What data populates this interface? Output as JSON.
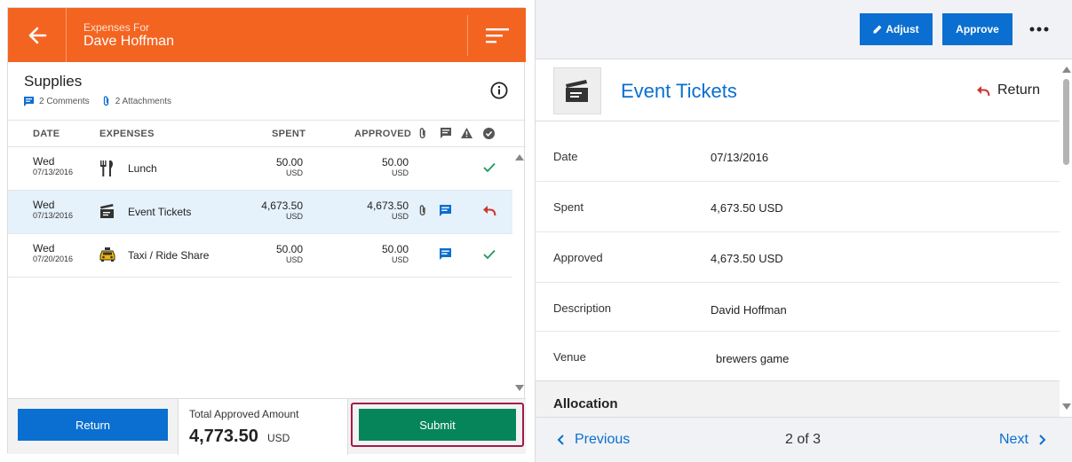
{
  "header": {
    "subtitle": "Expenses For",
    "name": "Dave Hoffman",
    "back_icon": "back-arrow-icon",
    "sort_icon": "sort-icon"
  },
  "report": {
    "title": "Supplies",
    "comments": "2 Comments",
    "attachments": "2 Attachments"
  },
  "table": {
    "headers": {
      "date": "DATE",
      "expenses": "EXPENSES",
      "spent": "SPENT",
      "approved": "APPROVED"
    },
    "rows": [
      {
        "day": "Wed",
        "date": "07/13/2016",
        "icon": "fork-knife-icon",
        "expense": "Lunch",
        "spent": "50.00",
        "spent_currency": "USD",
        "approved": "50.00",
        "approved_currency": "USD",
        "status": "approved"
      },
      {
        "day": "Wed",
        "date": "07/13/2016",
        "icon": "clapperboard-icon",
        "expense": "Event Tickets",
        "spent": "4,673.50",
        "spent_currency": "USD",
        "approved": "4,673.50",
        "approved_currency": "USD",
        "status": "returned"
      },
      {
        "day": "Wed",
        "date": "07/20/2016",
        "icon": "taxi-icon",
        "expense": "Taxi / Ride Share",
        "spent": "50.00",
        "spent_currency": "USD",
        "approved": "50.00",
        "approved_currency": "USD",
        "status": "approved"
      }
    ]
  },
  "footer": {
    "return_label": "Return",
    "total_label": "Total Approved Amount",
    "total_amount": "4,773.50",
    "total_currency": "USD",
    "submit_label": "Submit"
  },
  "toolbar": {
    "adjust_label": "Adjust",
    "approve_label": "Approve"
  },
  "detail": {
    "title": "Event Tickets",
    "return_label": "Return",
    "fields": [
      {
        "label": "Date",
        "value": "07/13/2016"
      },
      {
        "label": "Spent",
        "value": "4,673.50 USD"
      },
      {
        "label": "Approved",
        "value": "4,673.50 USD"
      },
      {
        "label": "Description",
        "value": "David Hoffman"
      },
      {
        "label": "Venue",
        "value": "brewers game"
      }
    ],
    "section": "Allocation"
  },
  "pager": {
    "previous": "Previous",
    "position": "2 of 3",
    "next": "Next"
  },
  "colors": {
    "header_orange": "#f46421",
    "accent_blue": "#0a6fd0",
    "submit_green": "#06855a",
    "approved_check": "#1a9a5a",
    "returned_red": "#d0342c",
    "selected_row": "#e5f1fb",
    "highlight_border": "#a3194b"
  }
}
